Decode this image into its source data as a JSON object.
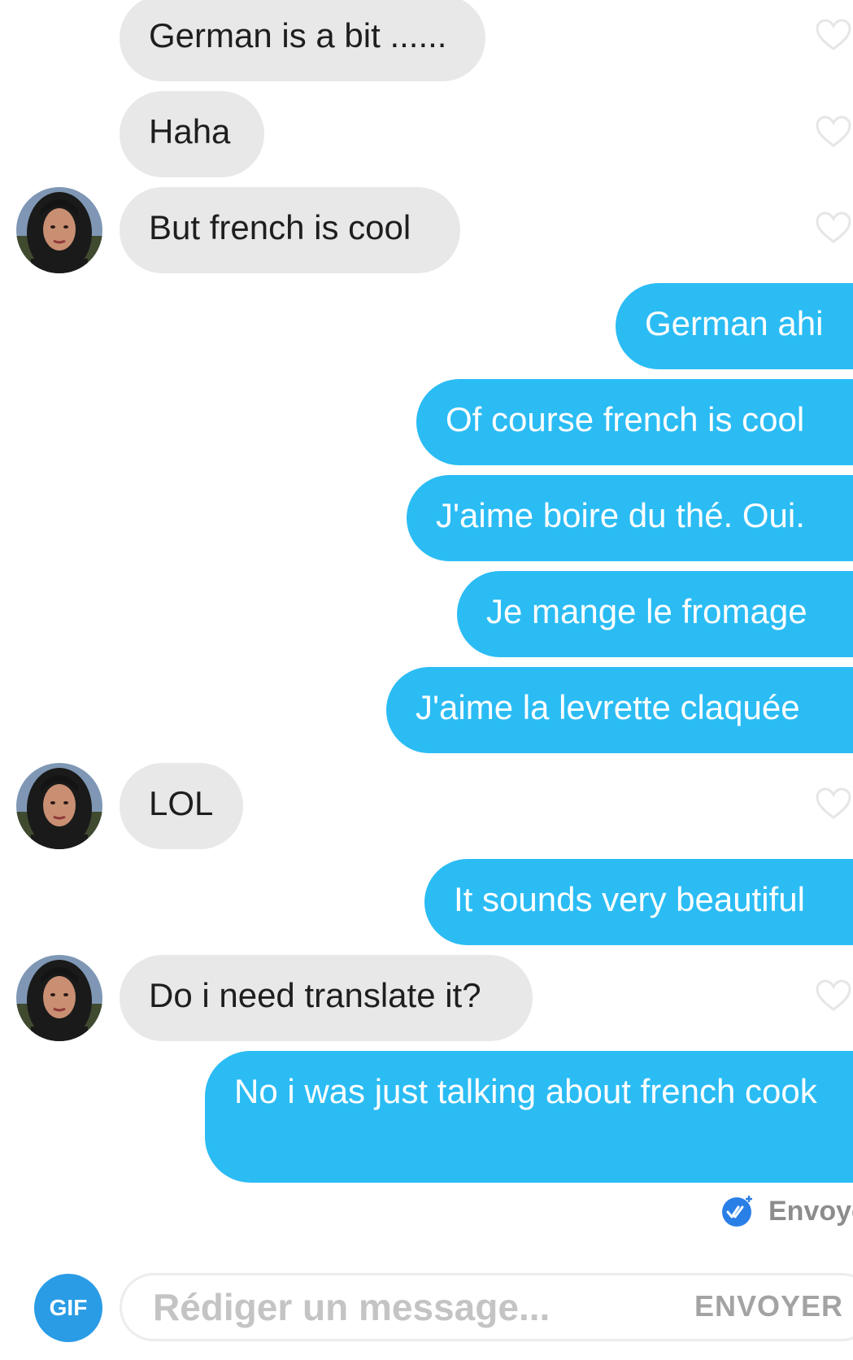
{
  "conversation": {
    "messages": [
      {
        "from": "them",
        "text": "German is a bit ......"
      },
      {
        "from": "them",
        "text": "Haha"
      },
      {
        "from": "them",
        "text": "But french is cool"
      },
      {
        "from": "me",
        "text": "German ahi"
      },
      {
        "from": "me",
        "text": "Of course french is cool"
      },
      {
        "from": "me",
        "text": "J'aime boire du thé. Oui."
      },
      {
        "from": "me",
        "text": "Je mange le fromage"
      },
      {
        "from": "me",
        "text": "J'aime la levrette claquée"
      },
      {
        "from": "them",
        "text": "LOL"
      },
      {
        "from": "me",
        "text": "It sounds very beautiful"
      },
      {
        "from": "them",
        "text": "Do i need translate it?"
      },
      {
        "from": "me",
        "text": "No i was just talking about french cook"
      }
    ],
    "status_label": "Envoyé"
  },
  "composer": {
    "gif_label": "GIF",
    "placeholder": "Rédiger un message...",
    "send_label": "ENVOYER"
  },
  "icons": {
    "like": "heart-outline-icon",
    "delivered": "double-check-icon",
    "avatar": "contact-avatar"
  },
  "colors": {
    "outgoing_bubble": "#2bbcf4",
    "incoming_bubble": "#e8e8e8",
    "gif_button": "#2a9ce6",
    "delivered_check": "#2a7fe6"
  }
}
